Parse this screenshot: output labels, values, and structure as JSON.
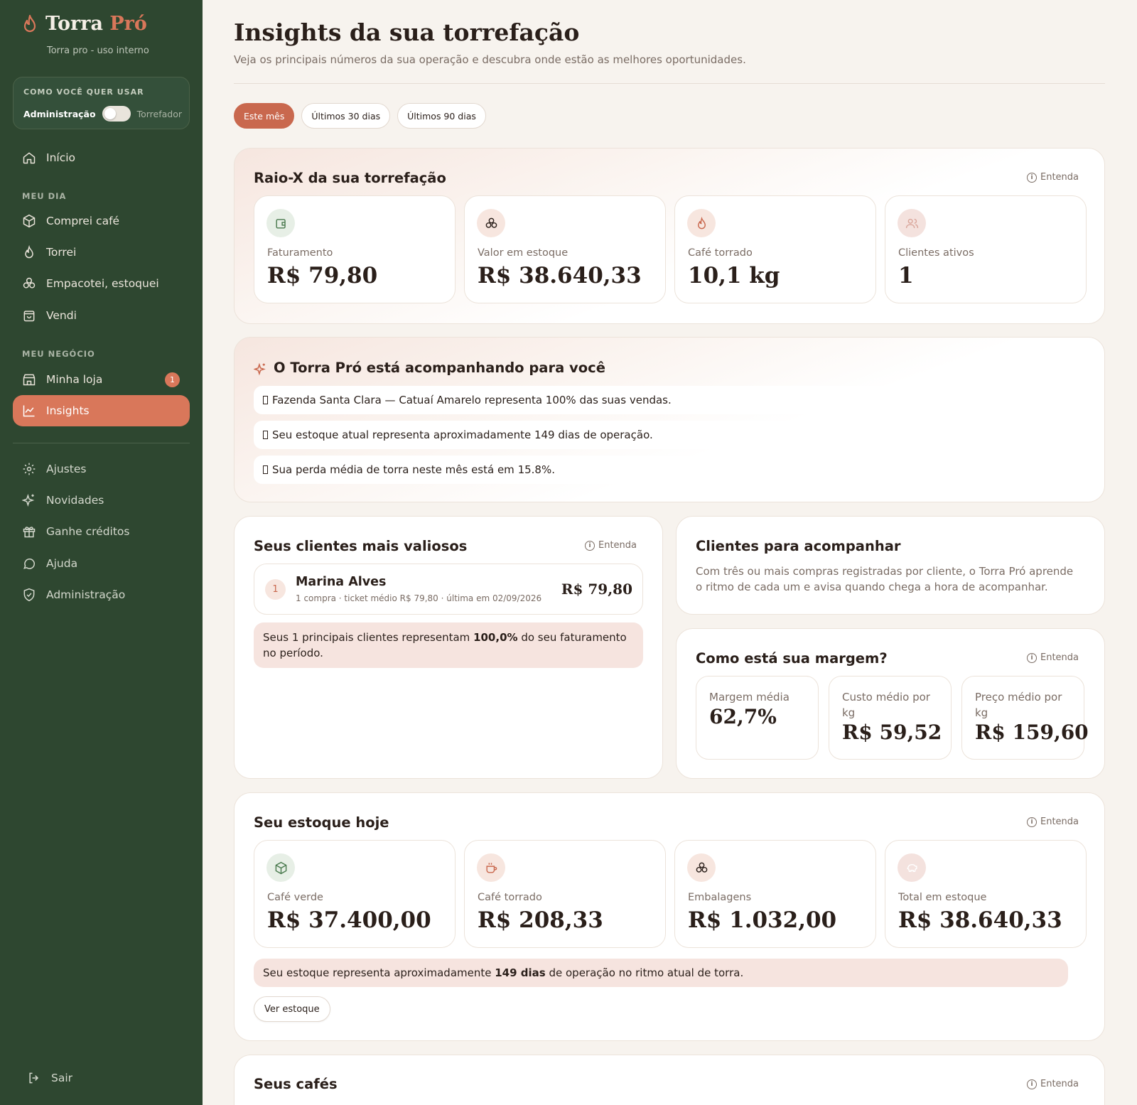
{
  "brand": {
    "name_main": "Torra",
    "name_accent": "Pró",
    "subtitle": "Torra pro - uso interno"
  },
  "mode": {
    "title": "COMO VOCÊ QUER USAR",
    "left": "Administração",
    "right": "Torrefador"
  },
  "nav": {
    "meu_dia_label": "MEU DIA",
    "meu_negocio_label": "MEU NEGÓCIO",
    "inicio": "Início",
    "comprei": "Comprei café",
    "torrei": "Torrei",
    "empacotei": "Empacotei, estoquei",
    "vendi": "Vendi",
    "minha_loja": "Minha loja",
    "minha_loja_badge": "1",
    "insights": "Insights",
    "ajustes": "Ajustes",
    "novidades": "Novidades",
    "ganhe": "Ganhe créditos",
    "ajuda": "Ajuda",
    "administracao": "Administração",
    "sair": "Sair"
  },
  "header": {
    "title": "Insights da sua torrefação",
    "subtitle": "Veja os principais números da sua operação e descubra onde estão as melhores oportunidades."
  },
  "filters": [
    "Este mês",
    "Últimos 30 dias",
    "Últimos 90 dias"
  ],
  "entenda": "Entenda",
  "raiox": {
    "title": "Raio-X da sua torrefação",
    "stats": [
      {
        "label": "Faturamento",
        "value": "R$ 79,80",
        "icon": "wallet-icon"
      },
      {
        "label": "Valor em estoque",
        "value": "R$ 38.640,33",
        "icon": "coffee-beans-icon"
      },
      {
        "label": "Café torrado",
        "value": "10,1 kg",
        "icon": "flame-icon"
      },
      {
        "label": "Clientes ativos",
        "value": "1",
        "icon": "users-icon"
      }
    ]
  },
  "acompanhando": {
    "title": "O Torra Pró está acompanhando para você",
    "items": [
      "Fazenda Santa Clara — Catuaí Amarelo representa 100% das suas vendas.",
      "Seu estoque atual representa aproximadamente 149 dias de operação.",
      "Sua perda média de torra neste mês está em 15.8%."
    ]
  },
  "clientes": {
    "title": "Seus clientes mais valiosos",
    "rows": [
      {
        "rank": "1",
        "name": "Marina Alves",
        "meta": "1 compra · ticket médio R$ 79,80 · última em 02/09/2026",
        "value": "R$ 79,80"
      }
    ],
    "note_pre": "Seus 1 principais clientes representam ",
    "note_bold": "100,0%",
    "note_post": " do seu faturamento no período."
  },
  "acompanhar": {
    "title": "Clientes para acompanhar",
    "text": "Com três ou mais compras registradas por cliente, o Torra Pró aprende o ritmo de cada um e avisa quando chega a hora de acompanhar."
  },
  "margem": {
    "title": "Como está sua margem?",
    "items": [
      {
        "label": "Margem média",
        "value": "62,7%"
      },
      {
        "label": "Custo médio por kg",
        "value": "R$ 59,52"
      },
      {
        "label": "Preço médio por kg",
        "value": "R$ 159,60"
      }
    ]
  },
  "estoque": {
    "title": "Seu estoque hoje",
    "stats": [
      {
        "label": "Café verde",
        "value": "R$ 37.400,00",
        "icon": "package-icon"
      },
      {
        "label": "Café torrado",
        "value": "R$ 208,33",
        "icon": "coffee-cup-icon"
      },
      {
        "label": "Embalagens",
        "value": "R$ 1.032,00",
        "icon": "coffee-beans-icon"
      },
      {
        "label": "Total em estoque",
        "value": "R$ 38.640,33",
        "icon": "piggy-bank-icon"
      }
    ],
    "note_pre": "Seu estoque representa aproximadamente ",
    "note_bold": "149 dias",
    "note_post": " de operação no ritmo atual de torra.",
    "button": "Ver estoque"
  },
  "cafes": {
    "title": "Seus cafés"
  }
}
